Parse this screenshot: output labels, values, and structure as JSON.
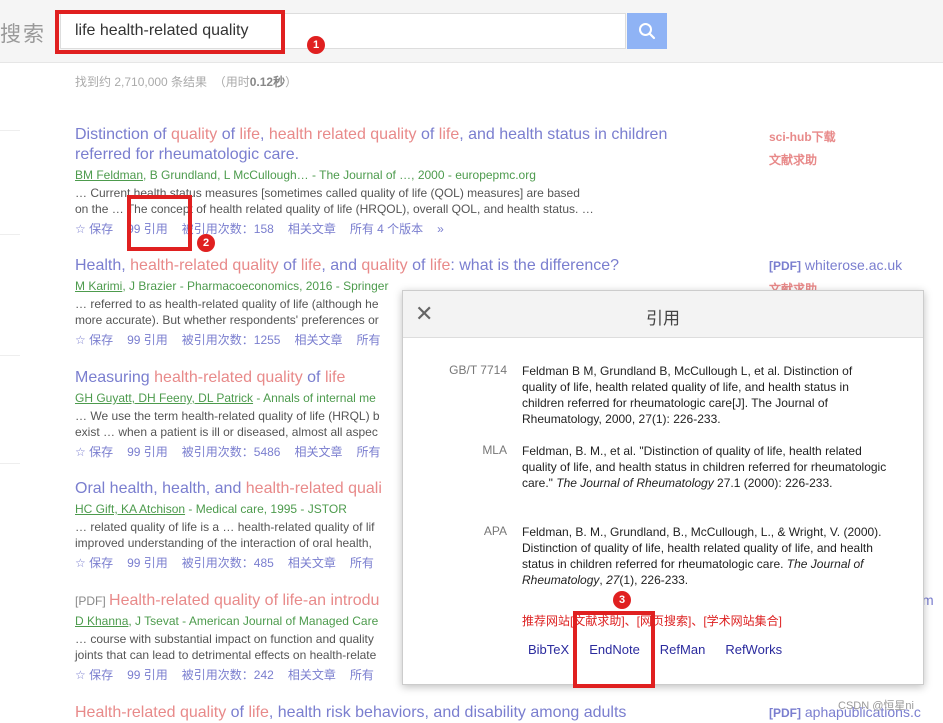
{
  "header": {
    "logo": "搜索",
    "search_value": "life health-related quality"
  },
  "stats": {
    "prefix": "找到约 2,710,000 条结果",
    "time_prefix": "（用时",
    "time": "0.12秒",
    "time_suffix": "）"
  },
  "results": [
    {
      "title_parts": [
        "Distinction of ",
        "quality",
        " of ",
        "life",
        ", ",
        "health related quality",
        " of ",
        "life",
        ", and health status in children referred for rheumatologic care."
      ],
      "meta_authors_u": "BM Feldman",
      "meta_rest": ", B Grundland, L McCullough… - The Journal of …, 2000 - europepmc.org",
      "snippet1": "… Current health status measures [sometimes called quality of life (QOL) measures] are based",
      "snippet2": "on the … The concept of health related quality of life (HRQOL), overall QOL, and health status. …",
      "actions": [
        "☆ 保存",
        "99 引用",
        "被引用次数：158",
        "相关文章",
        "所有 4 个版本",
        "»"
      ]
    },
    {
      "title_parts": [
        "Health, ",
        "health-related quality",
        " of ",
        "life",
        ", and ",
        "quality",
        " of ",
        "life",
        ": what is the difference?"
      ],
      "meta_authors_u": "M Karimi",
      "meta_rest": ", J Brazier - Pharmacoeconomics, 2016 - Springer",
      "snippet1": "… referred to as health-related quality of life (although he",
      "snippet2": "more accurate). But whether respondents' preferences or",
      "actions": [
        "☆ 保存",
        "99 引用",
        "被引用次数：1255",
        "相关文章",
        "所有"
      ]
    },
    {
      "title_parts": [
        "Measuring ",
        "health-related quality",
        " of ",
        "life"
      ],
      "meta_authors_u": "GH Guyatt, DH Feeny, DL Patrick",
      "meta_rest": " - Annals of internal me",
      "snippet1": "… We use the term health-related quality of life (HRQL) b",
      "snippet2": "exist … when a patient is ill or diseased, almost all aspec",
      "actions": [
        "☆ 保存",
        "99 引用",
        "被引用次数：5486",
        "相关文章",
        "所有"
      ]
    },
    {
      "title_parts": [
        "Oral health, health, and ",
        "health-related quali"
      ],
      "meta_authors_u": "HC Gift, KA Atchison",
      "meta_rest": " - Medical care, 1995 - JSTOR",
      "snippet1": "… related quality of life is a … health-related quality of lif",
      "snippet2": "improved understanding of the interaction of oral health,",
      "actions": [
        "☆ 保存",
        "99 引用",
        "被引用次数：485",
        "相关文章",
        "所有"
      ]
    },
    {
      "tag": "[PDF] ",
      "title_parts": [
        "Health-related quality",
        " of ",
        "life",
        "-an introdu"
      ],
      "meta_authors_u": "D Khanna",
      "meta_rest": ", J Tsevat - American Journal of Managed Care",
      "snippet1": "… course with substantial impact on function and quality",
      "snippet2": "joints that can lead to detrimental effects on health-relate",
      "actions": [
        "☆ 保存",
        "99 引用",
        "被引用次数：242",
        "相关文章",
        "所有"
      ]
    },
    {
      "title_parts": [
        "Health-related quality",
        " of ",
        "life",
        ", health risk behaviors, and disability among adults"
      ]
    }
  ],
  "sidebar": {
    "scihub": "sci-hub下载",
    "help": "文献求助",
    "pdf_tag": "[PDF]",
    "pdf1": "whiterose.ac.uk",
    "help2": "文献求助",
    "pdf_m": "m",
    "pdf_last_tag": "[PDF]",
    "pdf_last": "aphapublications.c"
  },
  "modal": {
    "title": "引用",
    "close": "✕",
    "citations": [
      {
        "style": "GB/T 7714",
        "text": "Feldman B M, Grundland B, McCullough L, et al. Distinction of quality of life, health related quality of life, and health status in children referred for rheumatologic care[J]. The Journal of Rheumatology, 2000, 27(1): 226-233."
      },
      {
        "style": "MLA",
        "text_a": "Feldman, B. M., et al. \"Distinction of quality of life, health related quality of life, and health status in children referred for rheumatologic care.\" ",
        "text_i": "The Journal of Rheumatology",
        "text_b": " 27.1 (2000): 226-233."
      },
      {
        "style": "APA",
        "text_a": "Feldman, B. M., Grundland, B., McCullough, L., & Wright, V. (2000). Distinction of quality of life, health related quality of life, and health status in children referred for rheumatologic care. ",
        "text_i": "The Journal of Rheumatology",
        "text_b": ", ",
        "text_i2": "27",
        "text_c": "(1), 226-233."
      }
    ],
    "links": "推荐网站[文献求助]、[网页搜索]、[学术网站集合]",
    "exports": [
      "BibTeX",
      "EndNote",
      "RefMan",
      "RefWorks"
    ]
  },
  "annotations": [
    "1",
    "2",
    "3"
  ],
  "watermark": "CSDN @恒星ni"
}
